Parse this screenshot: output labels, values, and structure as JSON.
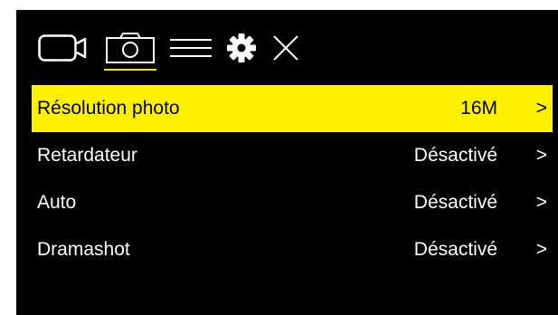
{
  "toolbar": {
    "icons": [
      "video-camera-icon",
      "photo-camera-icon",
      "menu-icon",
      "gear-icon",
      "close-icon"
    ],
    "active_tab": "photo-camera-icon",
    "accent_color": "#fff000"
  },
  "menu": {
    "items": [
      {
        "label": "Résolution photo",
        "value": "16M",
        "chevron": ">",
        "selected": true
      },
      {
        "label": "Retardateur",
        "value": "Désactivé",
        "chevron": ">",
        "selected": false
      },
      {
        "label": "Auto",
        "value": "Désactivé",
        "chevron": ">",
        "selected": false
      },
      {
        "label": "Dramashot",
        "value": "Désactivé",
        "chevron": ">",
        "selected": false
      }
    ]
  }
}
